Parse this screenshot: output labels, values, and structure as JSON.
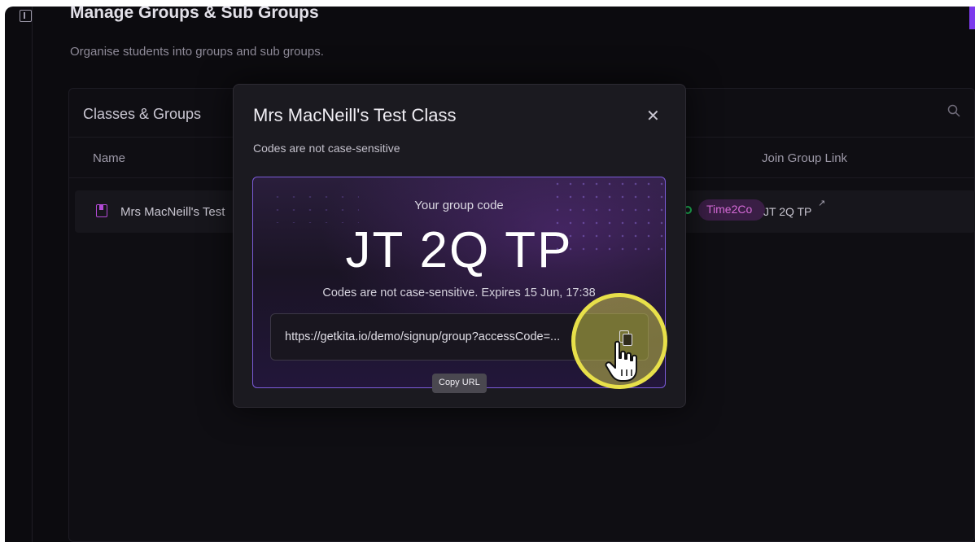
{
  "page": {
    "title": "Manage Groups & Sub Groups",
    "subtitle": "Organise students into groups and sub groups."
  },
  "card": {
    "title": "Classes & Groups",
    "search_icon": "search-icon",
    "columns": {
      "name": "Name",
      "join_link": "Join Group Link"
    },
    "row": {
      "name": "Mrs MacNeill's Test",
      "badge": "Time2Co",
      "join_code": "JT 2Q TP"
    }
  },
  "modal": {
    "title": "Mrs MacNeill's Test Class",
    "note": "Codes are not case-sensitive",
    "code_label": "Your group code",
    "code": "JT 2Q TP",
    "expires": "Codes are not case-sensitive. Expires 15 Jun, 17:38",
    "url": "https://getkita.io/demo/signup/group?accessCode=...",
    "tooltip": "Copy URL"
  },
  "colors": {
    "background": "#0c0b0f",
    "accent": "#7c3aed",
    "badge_text": "#d66bd8",
    "cursor_highlight": "#e8e04a"
  }
}
